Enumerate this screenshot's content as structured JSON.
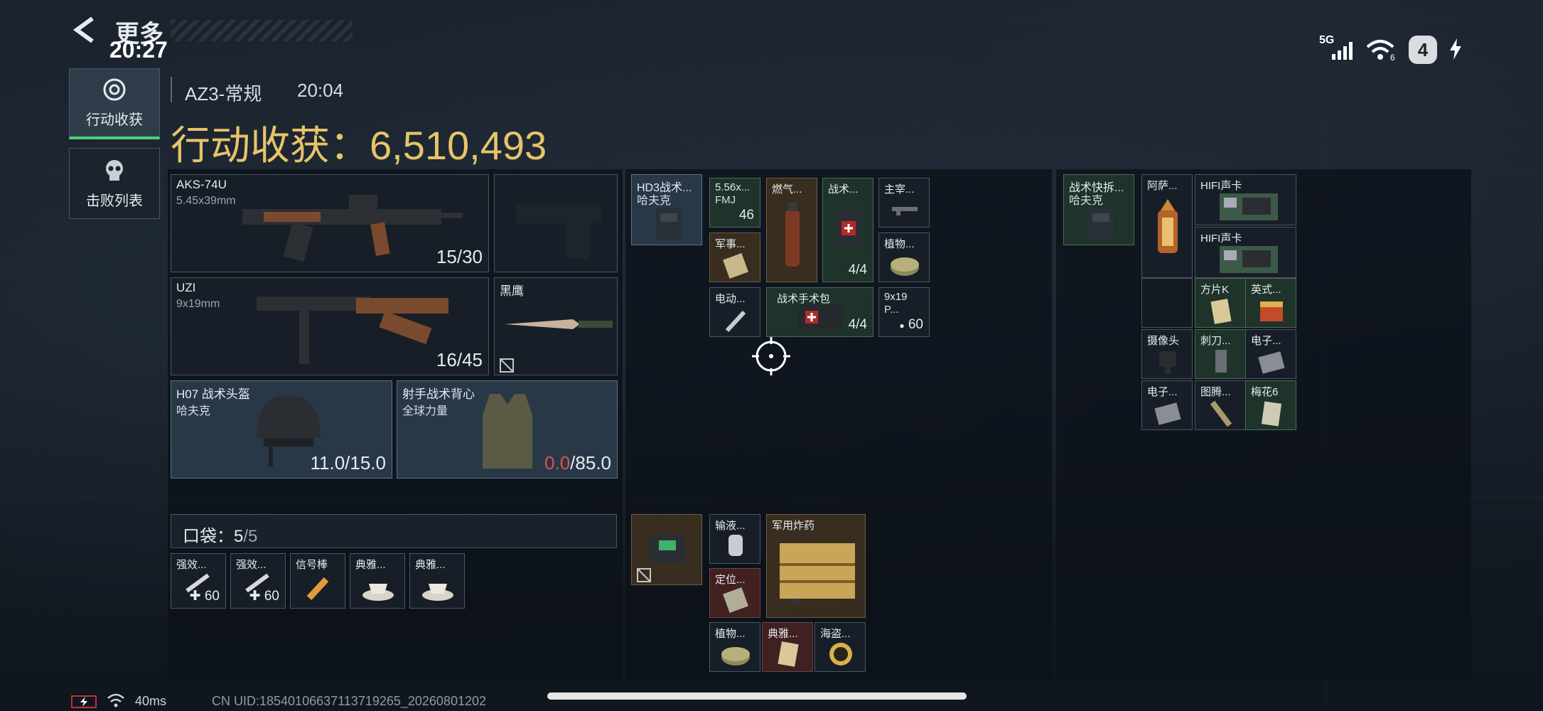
{
  "status_bar": {
    "time": "20:27",
    "signal": "5G",
    "wifi_sub": "6",
    "battery": "4"
  },
  "nav": {
    "back_label": "更多"
  },
  "sidebar": {
    "items": [
      {
        "label": "行动收获"
      },
      {
        "label": "击败列表"
      }
    ]
  },
  "header": {
    "map": "AZ3-常规",
    "duration": "20:04",
    "title_label": "行动收获：",
    "total": "6,510,493"
  },
  "loadout": {
    "primary": {
      "name": "AKS-74U",
      "ammo_type": "5.45x39mm",
      "ammo": "15/30"
    },
    "pistol": {
      "name": ""
    },
    "secondary": {
      "name": "UZI",
      "ammo_type": "9x19mm",
      "ammo": "16/45"
    },
    "melee": {
      "name": "黑鹰"
    },
    "helmet": {
      "name": "H07 战术头盔",
      "brand": "哈夫克",
      "durability": "11.0/15.0"
    },
    "armor": {
      "name": "射手战术背心",
      "brand": "全球力量",
      "durability_cur": "0.0",
      "durability_max": "/85.0"
    },
    "pocket": {
      "label": "口袋：",
      "count": "5",
      "max": "/5"
    },
    "pocket_items": [
      {
        "name": "强效...",
        "qty": "60"
      },
      {
        "name": "强效...",
        "qty": "60"
      },
      {
        "name": "信号棒"
      },
      {
        "name": "典雅..."
      },
      {
        "name": "典雅..."
      }
    ]
  },
  "chest_rig": {
    "name": "HD3战术...",
    "brand": "哈夫克",
    "items": [
      {
        "name": "5.56x...",
        "sub": "FMJ",
        "qty": "46"
      },
      {
        "name": "燃气..."
      },
      {
        "name": "战术...",
        "qty": "4/4"
      },
      {
        "name": "主宰..."
      },
      {
        "name": "军事..."
      },
      {
        "name": "植物..."
      },
      {
        "name": "电动..."
      },
      {
        "name": "战术手术包",
        "qty": "4/4"
      },
      {
        "name": "9x19",
        "sub": "P...",
        "qty": "60"
      }
    ]
  },
  "backpack": {
    "items": [
      {
        "name": "输液..."
      },
      {
        "name": "军用炸药"
      },
      {
        "name": "定位..."
      },
      {
        "name": "植物..."
      },
      {
        "name": "典雅..."
      },
      {
        "name": "海盗..."
      }
    ]
  },
  "safe_box": {
    "name": "战术快拆...",
    "brand": "哈夫克",
    "items": [
      {
        "name": "阿萨..."
      },
      {
        "name": "HIFI声卡"
      },
      {
        "name": "HIFI声卡"
      },
      {
        "name": "方片K"
      },
      {
        "name": "英式..."
      },
      {
        "name": "摄像头"
      },
      {
        "name": "刺刀..."
      },
      {
        "name": "电子..."
      },
      {
        "name": "电子..."
      },
      {
        "name": "图腾..."
      },
      {
        "name": "梅花6"
      }
    ]
  },
  "footer": {
    "ping": "40ms",
    "uid": "CN UID:18540106637113719265_20260801202"
  },
  "colors": {
    "gold": "#e7c46a",
    "red": "#e05050",
    "accent_green": "#4fd07a"
  }
}
